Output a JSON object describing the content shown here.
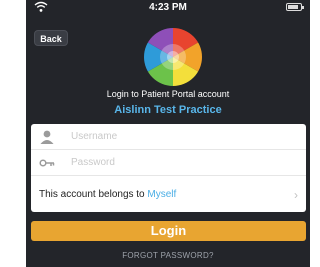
{
  "status_bar": {
    "time": "4:23 PM",
    "wifi_icon": "wifi-icon",
    "battery_icon": "battery-icon"
  },
  "nav": {
    "back_label": "Back"
  },
  "logo": {
    "icon": "colorful-sphere-logo"
  },
  "header": {
    "subtitle": "Login to Patient Portal account",
    "practice_name": "Aislinn Test Practice",
    "practice_color": "#59b6ea"
  },
  "form": {
    "username": {
      "placeholder": "Username",
      "value": "",
      "icon": "user-icon"
    },
    "password": {
      "placeholder": "Password",
      "value": "",
      "icon": "key-icon"
    },
    "account_owner": {
      "prefix": "This account belongs to ",
      "value": "Myself",
      "chevron": "›"
    }
  },
  "actions": {
    "login_label": "Login",
    "login_color": "#e8a531",
    "forgot_label": "FORGOT PASSWORD?"
  },
  "colors": {
    "background": "#23252a"
  }
}
